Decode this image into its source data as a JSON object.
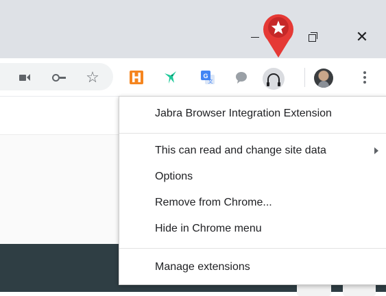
{
  "window_controls": {
    "restore_label": "Restore down",
    "close_glyph": "✕"
  },
  "toolbar": {
    "icons": [
      "camera-icon",
      "key-icon",
      "star-icon"
    ],
    "extensions": [
      "honey-icon",
      "hummingbird-icon",
      "google-translate-icon",
      "speech-bubble-icon",
      "jabra-headset-icon"
    ],
    "star_glyph": "☆",
    "avatar_icon": "profile-avatar",
    "menu_icon": "more-vert-icon"
  },
  "annotation": {
    "icon": "red-star-pin-marker",
    "color": "#e53935"
  },
  "context_menu": {
    "title": "Jabra Browser Integration Extension",
    "items": [
      {
        "label": "This can read and change site data",
        "has_submenu": true
      },
      {
        "label": "Options"
      },
      {
        "label": "Remove from Chrome..."
      },
      {
        "label": "Hide in Chrome menu"
      }
    ],
    "footer": "Manage extensions"
  },
  "colors": {
    "titlebar": "#dee1e6",
    "page_dark": "#2f3e44",
    "icon_gray": "#5f6368"
  }
}
